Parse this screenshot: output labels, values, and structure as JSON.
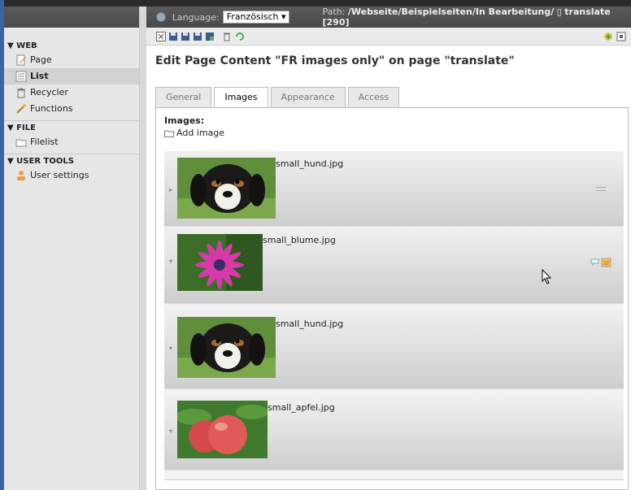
{
  "sidebar": {
    "sections": [
      {
        "title": "▼ WEB",
        "items": [
          {
            "label": "Page",
            "icon": "page-edit-icon"
          },
          {
            "label": "List",
            "icon": "list-icon",
            "active": true
          },
          {
            "label": "Recycler",
            "icon": "recycler-icon"
          },
          {
            "label": "Functions",
            "icon": "wand-icon"
          }
        ]
      },
      {
        "title": "▼ FILE",
        "items": [
          {
            "label": "Filelist",
            "icon": "folder-icon"
          }
        ]
      },
      {
        "title": "▼ USER TOOLS",
        "items": [
          {
            "label": "User settings",
            "icon": "user-icon"
          }
        ]
      }
    ]
  },
  "docheader": {
    "language_label": "Language:",
    "language_value": "Französisch",
    "path_label": "Path:",
    "path_value": "/Webseite/Beispielseiten/In Bearbeitung/",
    "page_name": "translate [290]"
  },
  "page_title": "Edit Page Content \"FR images only\" on page \"translate\"",
  "tabs": [
    {
      "label": "General",
      "active": false
    },
    {
      "label": "Images",
      "active": true
    },
    {
      "label": "Appearance",
      "active": false
    },
    {
      "label": "Access",
      "active": false
    }
  ],
  "images_label": "Images:",
  "add_image": "Add image",
  "images": [
    {
      "filename": "small_hund.jpg",
      "subject": "dog"
    },
    {
      "filename": "small_blume.jpg",
      "subject": "flower"
    },
    {
      "filename": "small_hund.jpg",
      "subject": "dog"
    },
    {
      "filename": "small_apfel.jpg",
      "subject": "apple"
    }
  ],
  "colors": {
    "accent": "#3a64a4",
    "header": "#4f4f4f"
  }
}
